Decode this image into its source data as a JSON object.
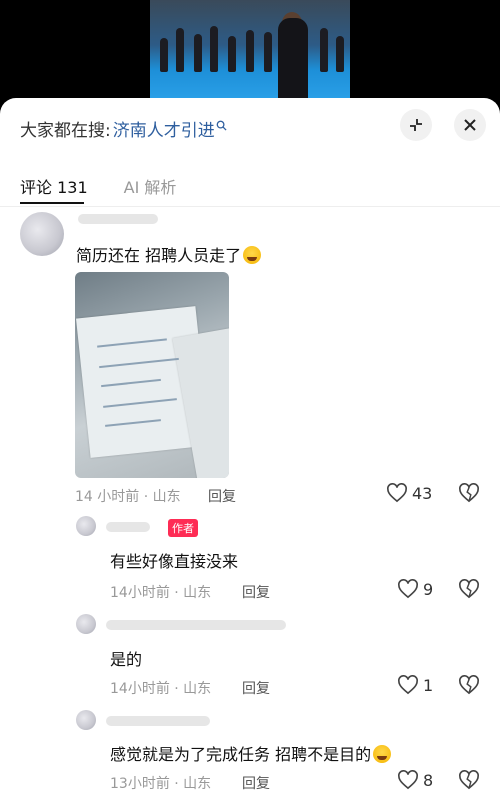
{
  "search": {
    "prefix": "大家都在搜:",
    "term": "济南人才引进"
  },
  "tabs": [
    {
      "label": "评论 131"
    },
    {
      "label": "AI 解析"
    }
  ],
  "comments": [
    {
      "text": "简历还在 招聘人员走了",
      "meta": "14 小时前 · 山东",
      "reply": "回复",
      "likes": "43"
    },
    {
      "text": "有些好像直接没来",
      "meta": "14小时前 · 山东",
      "reply": "回复",
      "likes": "9",
      "badge": "作者"
    },
    {
      "text": "是的",
      "meta": "14小时前 · 山东",
      "reply": "回复",
      "likes": "1"
    },
    {
      "text": "感觉就是为了完成任务 招聘不是目的",
      "meta": "13小时前 · 山东",
      "reply": "回复",
      "likes": "8"
    }
  ],
  "colors": {
    "link": "#2f5f9f",
    "badge": "#fe2c55"
  },
  "icons": [
    "search-icon",
    "collapse-icon",
    "close-icon",
    "heart-icon",
    "broken-heart-icon",
    "emoji-icon"
  ]
}
